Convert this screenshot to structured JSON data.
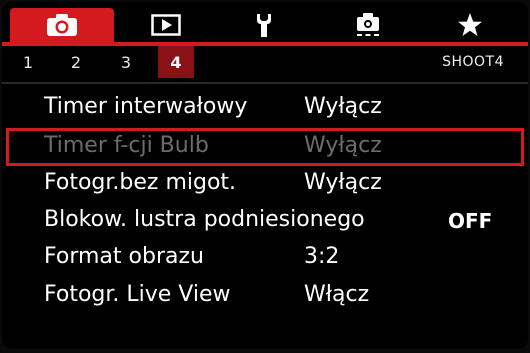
{
  "tabs": [
    {
      "icon": "camera-icon",
      "active": true
    },
    {
      "icon": "playback-icon",
      "active": false
    },
    {
      "icon": "wrench-icon",
      "active": false
    },
    {
      "icon": "custom-functions-icon",
      "active": false
    },
    {
      "icon": "star-icon",
      "active": false
    }
  ],
  "subtabs": [
    "1",
    "2",
    "3",
    "4"
  ],
  "active_subtab": "4",
  "page_code": "SHOOT4",
  "menu": [
    {
      "label": "Timer interwałowy",
      "value": "Wyłącz"
    },
    {
      "label": "Timer f-cji Bulb",
      "value": "Wyłącz"
    },
    {
      "label": "Fotogr.bez migot.",
      "value": "Wyłącz"
    },
    {
      "label": "Blokow. lustra podniesionego",
      "value": "OFF"
    },
    {
      "label": "Format obrazu",
      "value": "3:2"
    },
    {
      "label": "Fotogr. Live View",
      "value": "Włącz"
    }
  ],
  "colors": {
    "accent": "#d31a1f",
    "active_subtab": "#8a1116",
    "disabled_text": "#6c6c6c"
  }
}
